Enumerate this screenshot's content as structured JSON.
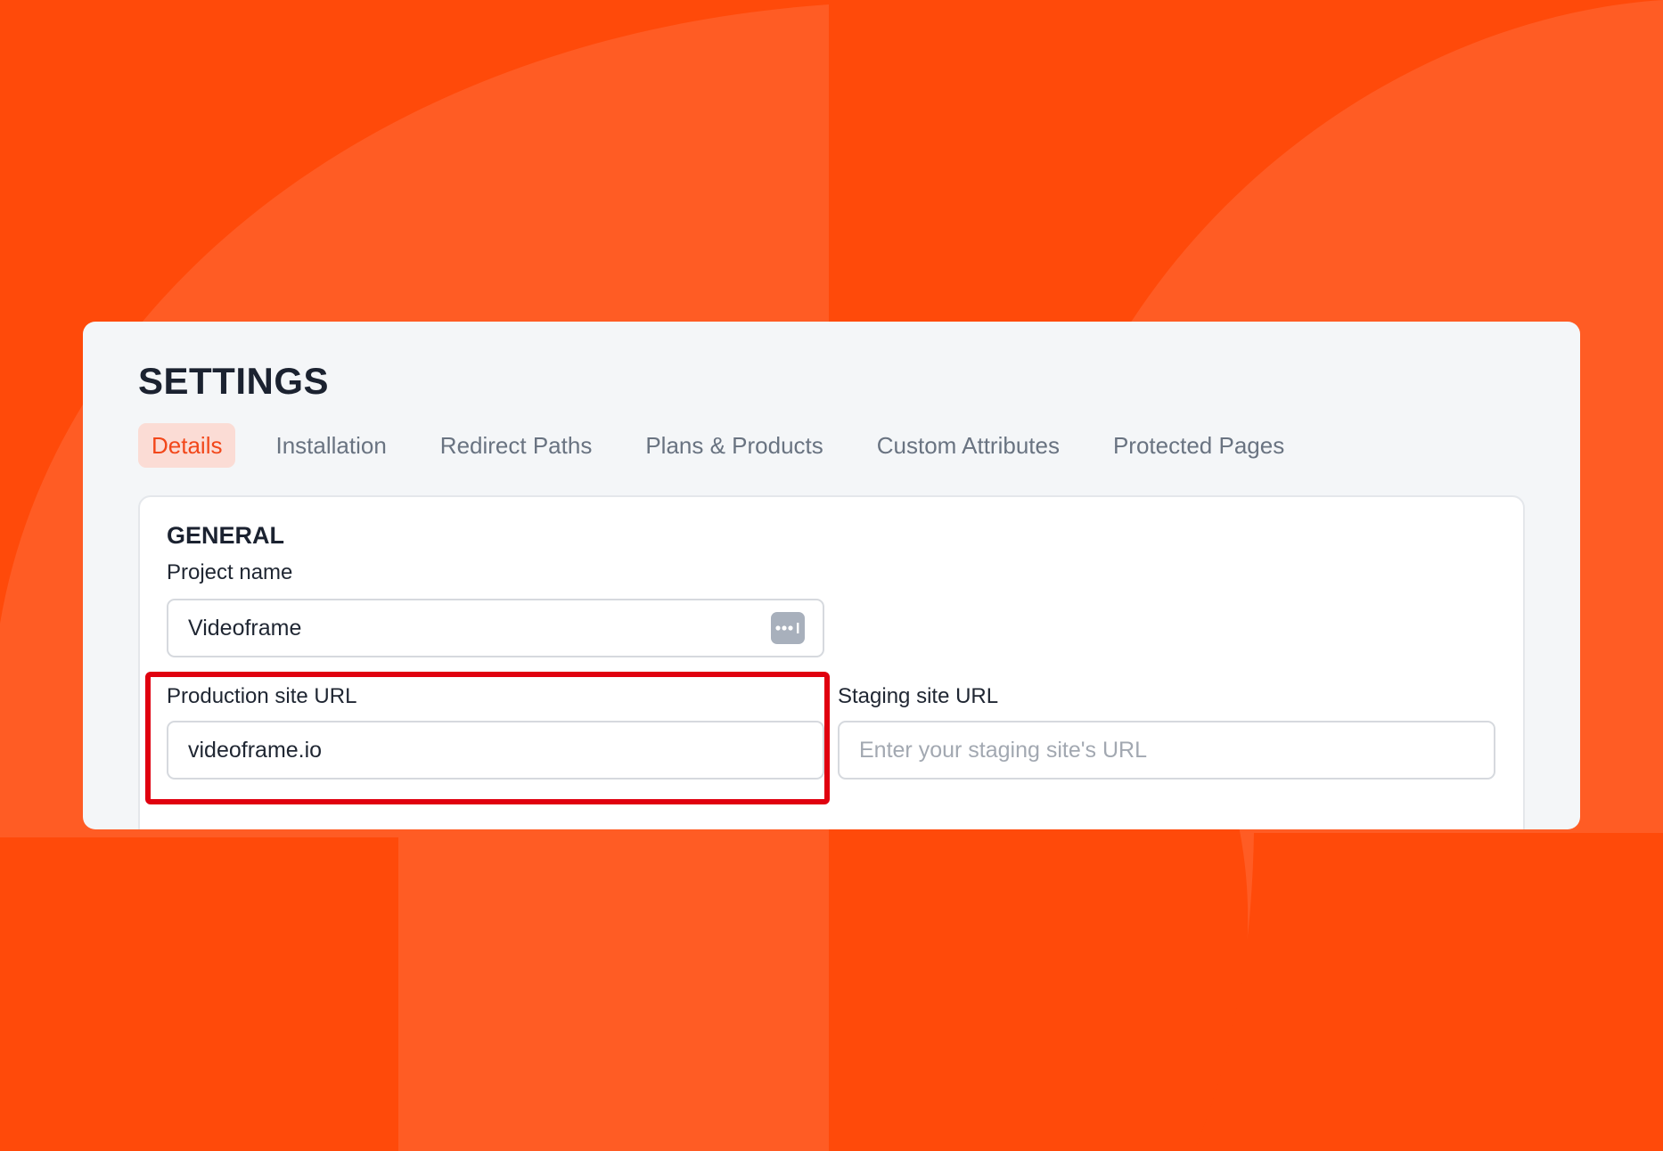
{
  "colors": {
    "background_orange": "#ff4a0a",
    "background_shape": "#ff5c24",
    "active_tab_text": "#f2471a",
    "active_tab_bg": "#fbdcd5",
    "highlight_border": "#e0000f"
  },
  "settings": {
    "title": "SETTINGS",
    "tabs": [
      {
        "label": "Details",
        "active": true
      },
      {
        "label": "Installation",
        "active": false
      },
      {
        "label": "Redirect Paths",
        "active": false
      },
      {
        "label": "Plans & Products",
        "active": false
      },
      {
        "label": "Custom Attributes",
        "active": false
      },
      {
        "label": "Protected Pages",
        "active": false
      }
    ]
  },
  "general": {
    "section_title": "GENERAL",
    "project_name": {
      "label": "Project name",
      "value": "Videoframe",
      "icon": "password-manager-icon"
    },
    "production_url": {
      "label": "Production site URL",
      "value": "videoframe.io"
    },
    "staging_url": {
      "label": "Staging site URL",
      "value": "",
      "placeholder": "Enter your staging site's URL"
    }
  }
}
